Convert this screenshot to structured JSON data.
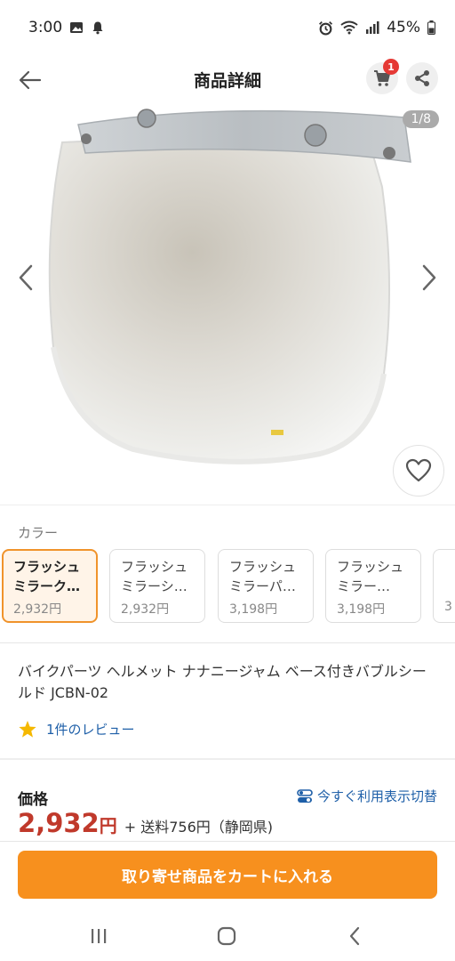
{
  "status_bar": {
    "time": "3:00",
    "battery": "45%"
  },
  "header": {
    "title": "商品詳細",
    "cart_count": "1"
  },
  "gallery": {
    "counter": "1/8"
  },
  "colors": {
    "label": "カラー",
    "variants": [
      {
        "name_line1": "フラッシュ",
        "name_line2": "ミラーク…",
        "price": "2,932円",
        "selected": true
      },
      {
        "name_line1": "フラッシュ",
        "name_line2": "ミラーシ…",
        "price": "2,932円",
        "selected": false
      },
      {
        "name_line1": "フラッシュ",
        "name_line2": "ミラーパ…",
        "price": "3,198円",
        "selected": false
      },
      {
        "name_line1": "フラッシュ",
        "name_line2": "ミラー…",
        "price": "3,198円",
        "selected": false
      },
      {
        "name_line1": "フ",
        "name_line2": "ミ",
        "price": "3",
        "selected": false
      }
    ]
  },
  "product": {
    "title": "バイクパーツ ヘルメット ナナニージャム ベース付きバブルシールド JCBN-02",
    "review_text": "1件のレビュー"
  },
  "price": {
    "label": "価格",
    "toggle_text": "今すぐ利用表示切替",
    "amount": "2,932",
    "unit": "円",
    "shipping": "+ 送料756円（静岡県)"
  },
  "cta": {
    "label": "取り寄せ商品をカートに入れる"
  },
  "theme": {
    "accent": "#f7901e",
    "price_red": "#c0392b",
    "link_blue": "#1e5fa8"
  }
}
